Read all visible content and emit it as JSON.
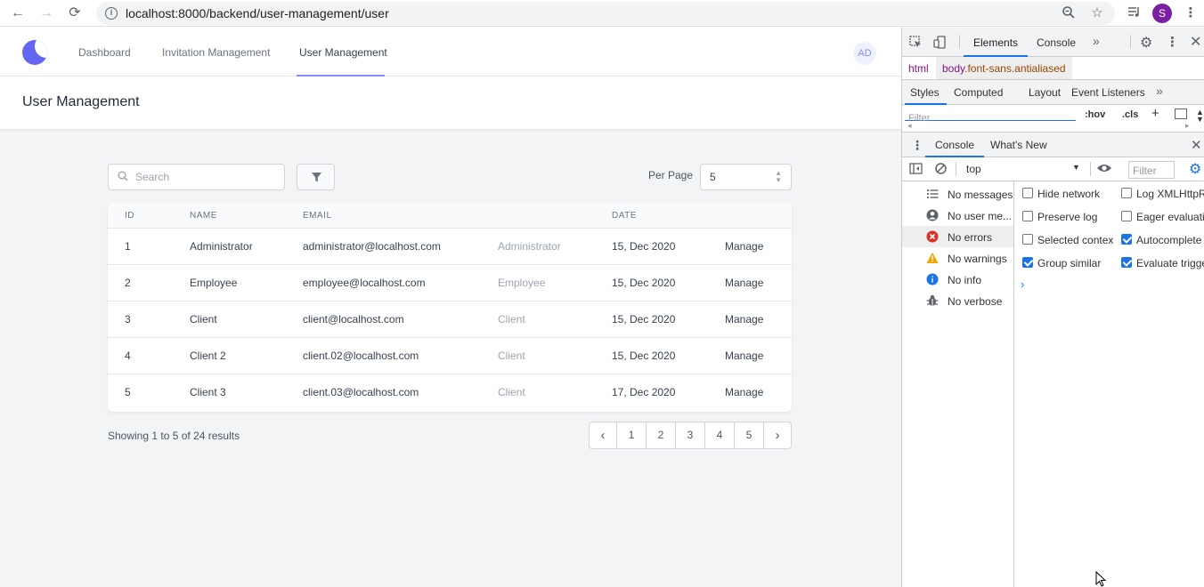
{
  "browser": {
    "url": "localhost:8000/backend/user-management/user",
    "profile_initial": "S"
  },
  "nav": {
    "links": [
      "Dashboard",
      "Invitation Management",
      "User Management"
    ],
    "active": "User Management",
    "avatar": "AD"
  },
  "page": {
    "title": "User Management"
  },
  "toolbar": {
    "search_placeholder": "Search",
    "per_page_label": "Per Page",
    "per_page_value": "5"
  },
  "table": {
    "columns": [
      "ID",
      "NAME",
      "EMAIL",
      "DATE"
    ],
    "rows": [
      {
        "id": "1",
        "name": "Administrator",
        "email": "administrator@localhost.com",
        "role": "Administrator",
        "date": "15, Dec 2020",
        "action": "Manage"
      },
      {
        "id": "2",
        "name": "Employee",
        "email": "employee@localhost.com",
        "role": "Employee",
        "date": "15, Dec 2020",
        "action": "Manage"
      },
      {
        "id": "3",
        "name": "Client",
        "email": "client@localhost.com",
        "role": "Client",
        "date": "15, Dec 2020",
        "action": "Manage"
      },
      {
        "id": "4",
        "name": "Client 2",
        "email": "client.02@localhost.com",
        "role": "Client",
        "date": "15, Dec 2020",
        "action": "Manage"
      },
      {
        "id": "5",
        "name": "Client 3",
        "email": "client.03@localhost.com",
        "role": "Client",
        "date": "17, Dec 2020",
        "action": "Manage"
      }
    ]
  },
  "pagination": {
    "summary": "Showing 1 to 5 of 24 results",
    "pages": [
      "1",
      "2",
      "3",
      "4",
      "5"
    ],
    "prev": "‹",
    "next": "›"
  },
  "devtools": {
    "tabs": [
      "Elements",
      "Console"
    ],
    "more": "»",
    "breadcrumb_html": "html",
    "breadcrumb_body_tag": "body",
    "breadcrumb_body_class": ".font-sans.antialiased",
    "subtabs": [
      "Styles",
      "Computed",
      "Layout",
      "Event Listeners"
    ],
    "filter_placeholder": "Filter",
    "hov": ":hov",
    "cls": ".cls",
    "drawer_tabs": [
      "Console",
      "What's New"
    ],
    "context": "top",
    "console_filter": "Filter",
    "sidebar": [
      "No messages",
      "No user me...",
      "No errors",
      "No warnings",
      "No info",
      "No verbose"
    ],
    "settings": [
      {
        "label": "Hide network",
        "checked": false
      },
      {
        "label": "Log XMLHttpR",
        "checked": false
      },
      {
        "label": "Preserve log",
        "checked": false
      },
      {
        "label": "Eager evaluatio",
        "checked": false
      },
      {
        "label": "Selected contex",
        "checked": false
      },
      {
        "label": "Autocomplete",
        "checked": true
      },
      {
        "label": "Group similar",
        "checked": true
      },
      {
        "label": "Evaluate trigge",
        "checked": true
      }
    ],
    "prompt": "›"
  },
  "colors": {
    "accent": "#6366f1",
    "devtools_blue": "#1a73e8"
  }
}
